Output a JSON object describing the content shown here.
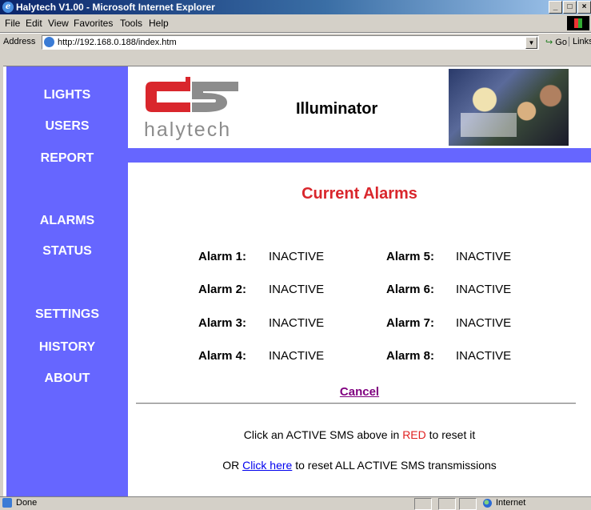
{
  "window": {
    "title": "Halytech V1.00 - Microsoft Internet Explorer",
    "icon": "ie-icon",
    "controls": [
      "minimize",
      "maximize",
      "close"
    ]
  },
  "menu": {
    "items": [
      "File",
      "Edit",
      "View",
      "Favorites",
      "Tools",
      "Help"
    ]
  },
  "address": {
    "label": "Address",
    "url": "http://192.168.0.188/index.htm",
    "go_label": "Go",
    "links_label": "Links"
  },
  "sidebar": {
    "color": "#6666ff",
    "items": [
      {
        "label": "LIGHTS"
      },
      {
        "label": "USERS"
      },
      {
        "label": "REPORT"
      },
      {
        "label": "ALARMS"
      },
      {
        "label": "STATUS"
      },
      {
        "label": "SETTINGS"
      },
      {
        "label": "HISTORY"
      },
      {
        "label": "ABOUT"
      }
    ]
  },
  "header": {
    "logo_text": "halytech",
    "app_name": "Illuminator"
  },
  "main": {
    "heading": "Current Alarms",
    "heading_color": "#d9262c",
    "alarms": [
      {
        "label": "Alarm 1:",
        "status": "INACTIVE"
      },
      {
        "label": "Alarm 2:",
        "status": "INACTIVE"
      },
      {
        "label": "Alarm 3:",
        "status": "INACTIVE"
      },
      {
        "label": "Alarm 4:",
        "status": "INACTIVE"
      },
      {
        "label": "Alarm 5:",
        "status": "INACTIVE"
      },
      {
        "label": "Alarm 6:",
        "status": "INACTIVE"
      },
      {
        "label": "Alarm 7:",
        "status": "INACTIVE"
      },
      {
        "label": "Alarm 8:",
        "status": "INACTIVE"
      }
    ],
    "cancel_label": "Cancel",
    "info_line1_pre": "Click an ACTIVE SMS above in ",
    "info_line1_red": "RED",
    "info_line1_post": " to reset it",
    "info_line2_pre": "OR ",
    "info_line2_link": "Click here",
    "info_line2_post": " to reset ALL ACTIVE SMS transmissions"
  },
  "status": {
    "text": "Done",
    "zone": "Internet"
  }
}
